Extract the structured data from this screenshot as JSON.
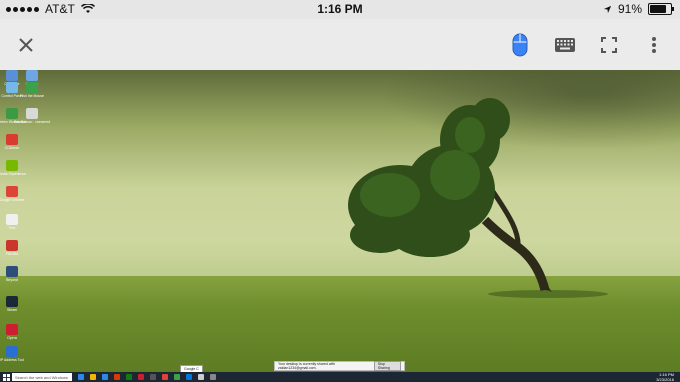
{
  "status_bar": {
    "carrier": "AT&T",
    "time": "1:16 PM",
    "battery_percent": "91%",
    "battery_level": 0.91
  },
  "toolbar": {
    "close_icon": "close-icon",
    "mouse_icon": "mouse-icon",
    "keyboard_icon": "keyboard-icon",
    "fullscreen_icon": "fullscreen-icon",
    "more_icon": "more-vertical-icon",
    "accent_color": "#3b82f6"
  },
  "desktop": {
    "icons": [
      {
        "label": "Computer",
        "color": "#5b8fd6"
      },
      {
        "label": "Network",
        "color": "#6fa5e0"
      },
      {
        "label": "Control Panel",
        "color": "#74b9e8"
      },
      {
        "label": "Find the Mouse",
        "color": "#3da04b"
      },
      {
        "label": "Webex Workstation",
        "color": "#3c9a45"
      },
      {
        "label": "Erin Bahour - unnamed",
        "color": "#d8d8d8"
      },
      {
        "label": "CCleaner",
        "color": "#d83b2f"
      },
      {
        "label": "Nvidia Experience",
        "color": "#76b900"
      },
      {
        "label": "Google Chrome",
        "color": "#db4437"
      },
      {
        "label": "Text",
        "color": "#f0f0f0"
      },
      {
        "label": "FileZilla",
        "color": "#c9372c"
      },
      {
        "label": "Beyond",
        "color": "#2d4d7a"
      },
      {
        "label": "Steam",
        "color": "#1b2838"
      },
      {
        "label": "Opera",
        "color": "#cc1f2f"
      },
      {
        "label": "IP Address Tool",
        "color": "#2b6fd1"
      }
    ],
    "taskbar": {
      "search_placeholder": "Search the web and Windows",
      "apps": [
        "#2b8ae6",
        "#f2b705",
        "#2b8ae6",
        "#d83b01",
        "#107c10",
        "#cc1f2f",
        "#555",
        "#db4437",
        "#3da04b",
        "#0078d7",
        "#ccc",
        "#888"
      ],
      "tray_time": "1:16 PM",
      "tray_date": "3/23/2016"
    },
    "tooltip": "Google C",
    "share_notice": {
      "text": "Your desktop is currently shared with zaidan1234@gmail.com.",
      "button": "Stop Sharing"
    }
  }
}
